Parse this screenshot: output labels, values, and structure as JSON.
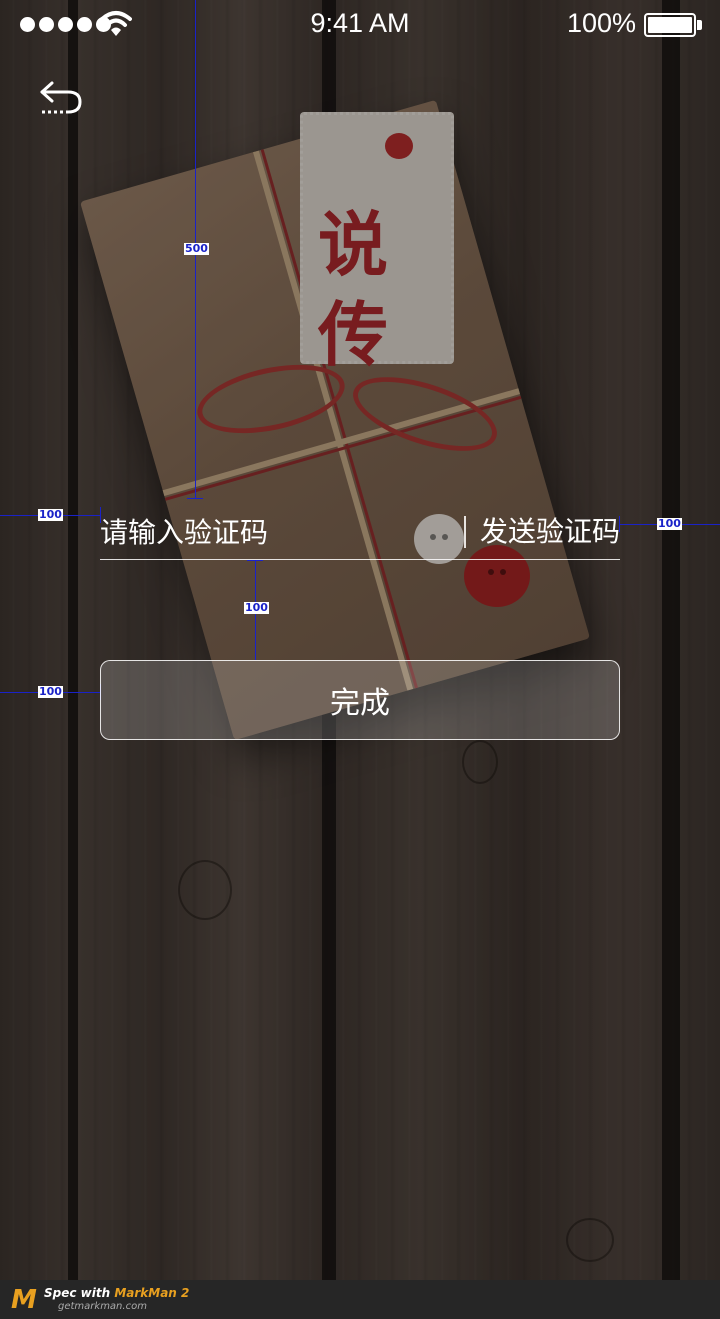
{
  "status_bar": {
    "time": "9:41 AM",
    "battery_percent": "100%",
    "signal_bars": 5,
    "icons": [
      "signal-dots-icon",
      "wifi-icon",
      "battery-icon"
    ]
  },
  "nav": {
    "back_icon": "back-arrow-icon"
  },
  "brand_tag": {
    "logo_text": "说传"
  },
  "form": {
    "code_placeholder": "请输入验证码",
    "send_code_label": "发送验证码",
    "submit_label": "完成"
  },
  "annotations": {
    "top_gap": "500",
    "input_left_margin": "100",
    "input_right_margin": "100",
    "input_to_button_gap": "100",
    "button_left_margin": "100"
  },
  "footer": {
    "logo_letter": "M",
    "spec_prefix": "Spec with ",
    "spec_brand": "MarkMan 2",
    "url": "getmarkman.com"
  },
  "colors": {
    "annotation_blue": "#1a22c8",
    "footer_accent": "#e8a020",
    "text": "#ffffff"
  }
}
